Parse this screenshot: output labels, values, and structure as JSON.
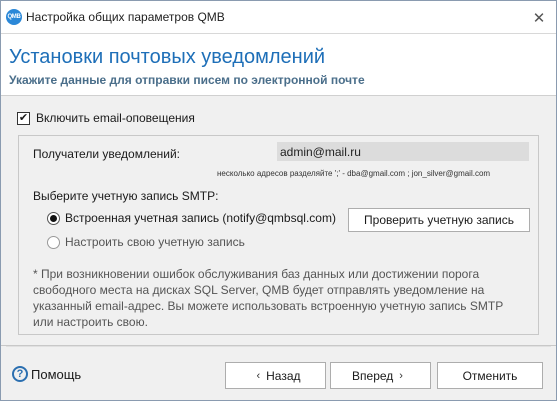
{
  "window": {
    "title": "Настройка общих параметров QMB",
    "icon_text": "QMB"
  },
  "header": {
    "title": "Установки почтовых уведомлений",
    "subtitle": "Укажите данные для отправки писем по электронной почте"
  },
  "enable_email": {
    "label": "Включить email-оповещения",
    "checked": true
  },
  "recipients": {
    "label": "Получатели уведомлений:",
    "value": "admin@mail.ru",
    "hint": "несколько адресов разделяйте ';' - dba@gmail.com ; jon_silver@gmail.com"
  },
  "smtp": {
    "label": "Выберите учетную запись SMTP:",
    "options": [
      {
        "label": "Встроенная учетная запись (notify@qmbsql.com)",
        "selected": true
      },
      {
        "label": "Настроить свою учетную запись",
        "selected": false
      }
    ],
    "check_button": "Проверить учетную запись"
  },
  "note": "* При возникновении ошибок обслуживания баз данных или достижении порога свободного места на дисках SQL Server, QMB будет отправлять уведомление на указанный email-адрес. Вы можете использовать встроенную учетную запись SMTP или настроить свою.",
  "footer": {
    "help_label": "Помощь",
    "back_label": "Назад",
    "next_label": "Вперед",
    "cancel_label": "Отменить"
  },
  "colors": {
    "accent": "#1e6fb8",
    "subtitle": "#4a6e8a",
    "input_bg": "#dcdcdc"
  }
}
